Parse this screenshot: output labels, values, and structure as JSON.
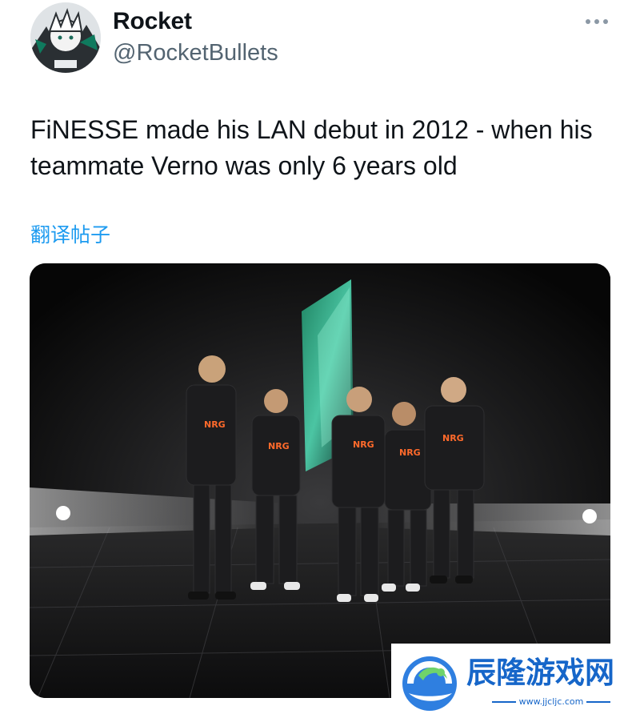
{
  "author": {
    "display_name": "Rocket",
    "handle": "@RocketBullets"
  },
  "actions": {
    "more_icon": "more-horizontal-icon"
  },
  "tweet": {
    "text_lines": [
      "FiNESSE made his LAN debut in 2012 - when his",
      "teammate Verno was only 6 years old"
    ],
    "translate_label": "翻译帖子"
  },
  "media": {
    "jersey_logo": "NRG"
  },
  "watermark": {
    "title": "辰隆游戏网",
    "url": "www.jjcljc.com"
  },
  "colors": {
    "link": "#1d9bf0",
    "text": "#0f1419",
    "secondary": "#536471",
    "watermark": "#1666c9"
  }
}
